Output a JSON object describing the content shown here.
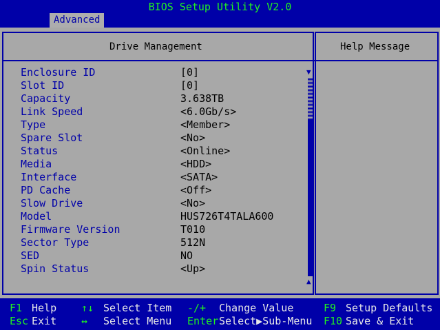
{
  "title": "BIOS Setup Utility V2.0",
  "tab": "Advanced",
  "main_heading": "Drive Management",
  "help_heading": "Help Message",
  "rows": [
    {
      "label": "Enclosure ID",
      "value": "[0]"
    },
    {
      "label": "Slot ID",
      "value": "[0]"
    },
    {
      "label": "Capacity",
      "value": "3.638TB"
    },
    {
      "label": "Link Speed",
      "value": "<6.0Gb/s>"
    },
    {
      "label": "Type",
      "value": "<Member>"
    },
    {
      "label": "Spare Slot",
      "value": "<No>"
    },
    {
      "label": "Status",
      "value": "<Online>"
    },
    {
      "label": "Media",
      "value": "<HDD>"
    },
    {
      "label": "Interface",
      "value": "<SATA>"
    },
    {
      "label": "PD Cache",
      "value": "<Off>"
    },
    {
      "label": "Slow Drive",
      "value": "<No>"
    },
    {
      "label": "Model",
      "value": "HUS726T4TALA600"
    },
    {
      "label": "Firmware Version",
      "value": "T010"
    },
    {
      "label": "Sector Type",
      "value": "512N"
    },
    {
      "label": "SED",
      "value": "NO"
    },
    {
      "label": "Spin Status",
      "value": "<Up>"
    }
  ],
  "scroll": {
    "up": "▲",
    "down": "▼"
  },
  "footer": {
    "f1_key": "F1",
    "f1_desc": "Help",
    "esc_key": "Esc",
    "esc_desc": "Exit",
    "ud_key": "↑↓",
    "ud_desc": "Select Item",
    "lr_key": "↔",
    "lr_desc": "Select Menu",
    "pm_key": "-/+",
    "pm_desc": "Change Value",
    "enter_key": "Enter",
    "enter_desc": "Select▶Sub-Menu",
    "f9_key": "F9",
    "f9_desc": "Setup Defaults",
    "f10_key": "F10",
    "f10_desc": "Save & Exit"
  },
  "colors": {
    "bg_blue": "#0000a8",
    "panel_gray": "#a8a8a8",
    "accent_green": "#21f121"
  }
}
